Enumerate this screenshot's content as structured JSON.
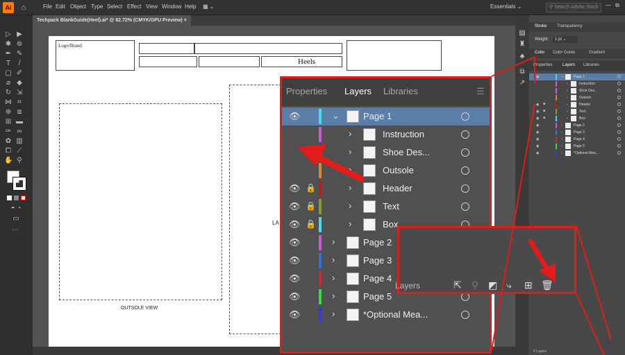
{
  "app": {
    "logo": "Ai",
    "menus": [
      "File",
      "Edit",
      "Object",
      "Type",
      "Select",
      "Effect",
      "View",
      "Window",
      "Help"
    ],
    "workspace": "Essentials",
    "search_placeholder": "Search Adobe Stock"
  },
  "document": {
    "tab_title": "Techpack BlankGuide(Heel).ai* @ 82.72% (CMYK/GPU Preview)",
    "close": "×"
  },
  "artboard": {
    "logo_label": "Logo/Brand",
    "heels_label": "Heels",
    "outsole_view": "OUTSOLE VIEW",
    "partial_label": "LA"
  },
  "big_panel": {
    "tabs": [
      "Properties",
      "Layers",
      "Libraries"
    ],
    "rows": [
      {
        "name": "Page 1",
        "color": "#4fd6e8",
        "selected": true,
        "expanded": true,
        "eye": true,
        "lock": false,
        "level": 0
      },
      {
        "name": "Instruction",
        "color": "#c85cd0",
        "eye": false,
        "lock": false,
        "level": 1
      },
      {
        "name": "Shoe Des...",
        "color": "#c85cd0",
        "eye": false,
        "lock": false,
        "level": 1
      },
      {
        "name": "Outsole",
        "color": "#d08a3a",
        "eye": false,
        "lock": false,
        "level": 1
      },
      {
        "name": "Header",
        "color": "#b02020",
        "eye": true,
        "lock": true,
        "level": 1
      },
      {
        "name": "Text",
        "color": "#8a9a3a",
        "eye": true,
        "lock": true,
        "level": 1
      },
      {
        "name": "Box",
        "color": "#4fd6e8",
        "eye": true,
        "lock": true,
        "level": 1
      },
      {
        "name": "Page 2",
        "color": "#c85cd0",
        "eye": true,
        "lock": false,
        "level": 0
      },
      {
        "name": "Page 3",
        "color": "#3a6fd8",
        "eye": true,
        "lock": false,
        "level": 0
      },
      {
        "name": "Page 4",
        "color": "#c03030",
        "eye": true,
        "lock": false,
        "level": 0
      },
      {
        "name": "Page 5",
        "color": "#3ad84a",
        "eye": true,
        "lock": false,
        "level": 0
      },
      {
        "name": "*Optional Mea...",
        "color": "#3a3ad0",
        "eye": true,
        "lock": false,
        "level": 0
      }
    ]
  },
  "zoom_box": {
    "label": "Layers"
  },
  "right_panel": {
    "stroke_tab": "Stroke",
    "transparency_tab": "Transparency",
    "weight_label": "Weight:",
    "weight_value": "1 pt",
    "color_tab": "Color",
    "color_guide_tab": "Color Guide",
    "gradient_tab": "Gradient",
    "tabs": [
      "Properties",
      "Layers",
      "Libraries"
    ],
    "layer_count": "6 Layers"
  },
  "colors": {
    "accent": "#e21b1b",
    "selected_row": "#5a7ea8"
  }
}
